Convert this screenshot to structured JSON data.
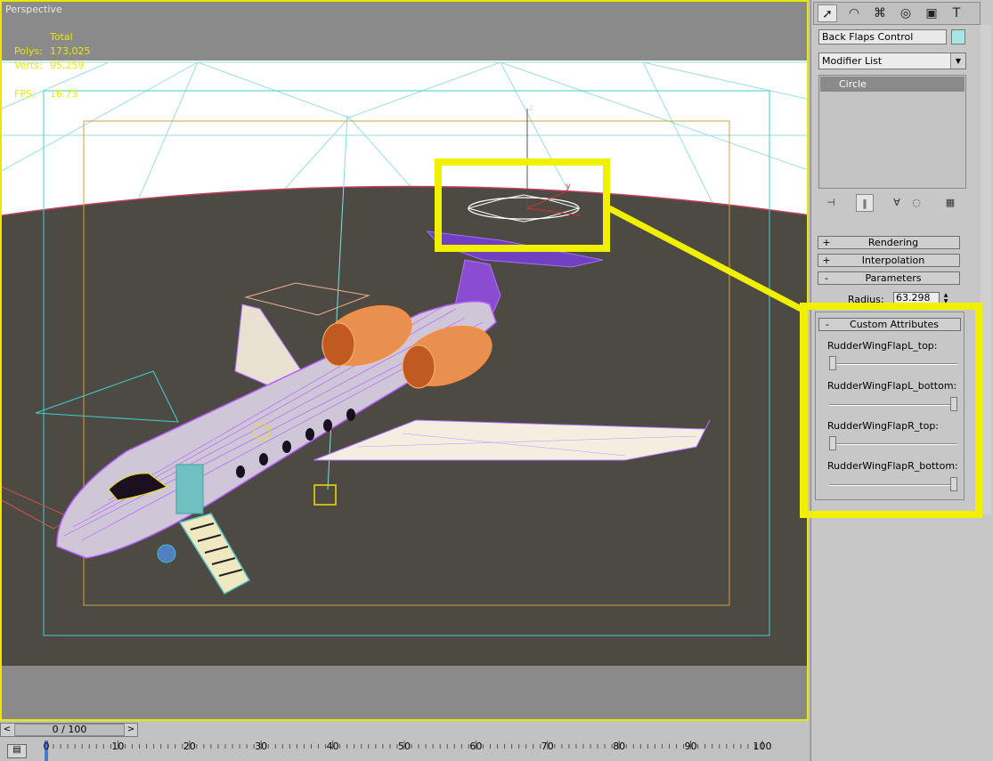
{
  "viewport": {
    "label": "Perspective",
    "stats": {
      "header": "Total",
      "rows": [
        {
          "key": "Polys:",
          "value": "173,025"
        },
        {
          "key": "Verts:",
          "value": "95,259"
        }
      ],
      "fps_key": "FPS:",
      "fps_value": "16.73"
    },
    "gizmo_axes": {
      "z": "z",
      "y": "y"
    }
  },
  "timeline": {
    "frame": "0 / 100",
    "prev_arrow": "<",
    "next_arrow": ">",
    "ticks": [
      "0",
      "10",
      "20",
      "30",
      "40",
      "50",
      "60",
      "70",
      "80",
      "90",
      "100"
    ]
  },
  "panel": {
    "tabs": [
      "create-icon",
      "modify-icon",
      "hierarchy-icon",
      "motion-icon",
      "display-icon",
      "utilities-icon"
    ],
    "object_name": "Back Flaps Control",
    "object_color": "#a8e6e6",
    "modifier_list": "Modifier List",
    "stack": [
      "Circle"
    ],
    "rollouts": [
      {
        "sign": "+",
        "title": "Rendering"
      },
      {
        "sign": "+",
        "title": "Interpolation"
      },
      {
        "sign": "-",
        "title": "Parameters"
      }
    ],
    "radius_label": "Radius:",
    "radius_value": "63.298",
    "custom_attributes": {
      "sign": "-",
      "title": "Custom Attributes",
      "sliders": [
        {
          "label": "RudderWingFlapL_top:",
          "value": 0.0
        },
        {
          "label": "RudderWingFlapL_bottom:",
          "value": 1.0
        },
        {
          "label": "RudderWingFlapR_top:",
          "value": 0.0
        },
        {
          "label": "RudderWingFlapR_bottom:",
          "value": 1.0
        }
      ]
    }
  },
  "colors": {
    "highlight": "#f0f000",
    "wire_purple": "#b45cff",
    "wire_orange": "#ff8c3c",
    "safe_frame_cyan": "#40d0d0",
    "safe_frame_orange": "#d0a040"
  }
}
